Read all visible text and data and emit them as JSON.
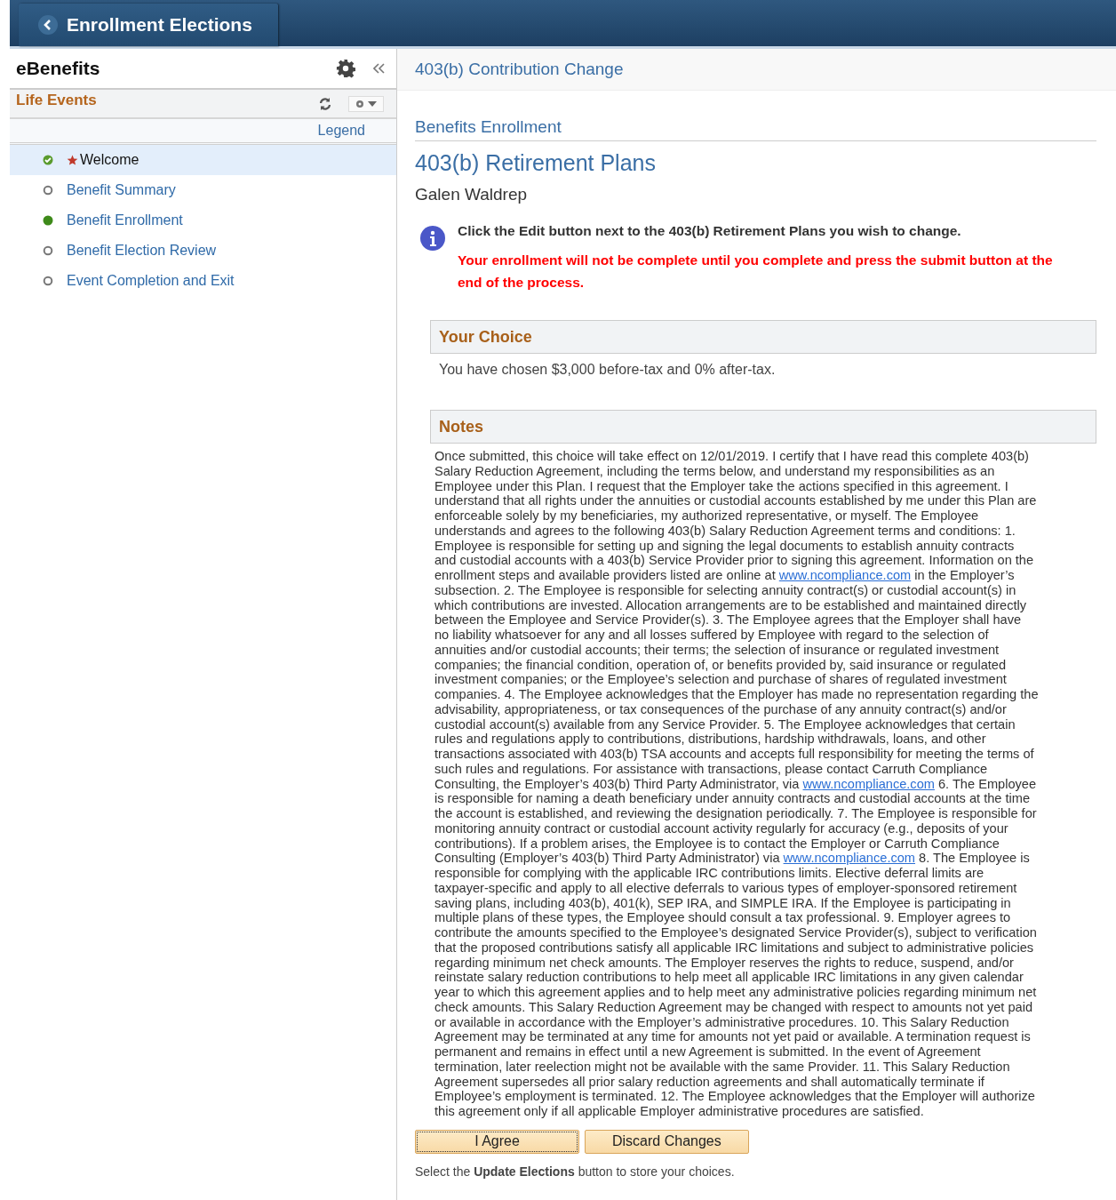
{
  "header": {
    "title": "Enrollment Elections"
  },
  "sidebar": {
    "title": "eBenefits",
    "section": "Life Events",
    "legend": "Legend",
    "items": [
      {
        "label": "Welcome",
        "kind": "complete",
        "required": true,
        "selected": true
      },
      {
        "label": "Benefit Summary",
        "kind": "pending",
        "required": false,
        "selected": false
      },
      {
        "label": "Benefit Enrollment",
        "kind": "current",
        "required": false,
        "selected": false
      },
      {
        "label": "Benefit Election Review",
        "kind": "pending",
        "required": false,
        "selected": false
      },
      {
        "label": "Event Completion and Exit",
        "kind": "pending",
        "required": false,
        "selected": false
      }
    ]
  },
  "content": {
    "page_title": "403(b) Contribution Change",
    "section": "Benefits Enrollment",
    "heading": "403(b) Retirement Plans",
    "employee": "Galen Waldrep",
    "info": "Click the Edit button next to the 403(b) Retirement Plans you wish to change.",
    "warning": "Your enrollment will not be complete until you complete and press the submit button at the end of the process.",
    "choice": {
      "title": "Your Choice",
      "text": "You have chosen $3,000 before-tax and 0% after-tax."
    },
    "notes": {
      "title": "Notes",
      "segments": [
        {
          "kind": "text",
          "text": "Once submitted, this choice will take effect on 12/01/2019. I certify that I have read this complete 403(b) Salary Reduction Agreement, including the terms below, and understand my responsibilities as an Employee under this Plan. I request that the Employer take the actions specified in this agreement. I understand that all rights under the annuities or custodial accounts established by me under this Plan are enforceable solely by my beneficiaries, my authorized representative, or myself. The Employee understands and agrees to the following 403(b) Salary Reduction Agreement terms and conditions: 1. Employee is responsible for setting up and signing the legal documents to establish annuity contracts and custodial accounts with a 403(b) Service Provider prior to signing this agreement. Information on the enrollment steps and available providers listed are online at "
        },
        {
          "kind": "link",
          "text": "www.ncompliance.com"
        },
        {
          "kind": "text",
          "text": " in the Employer’s subsection. 2. The Employee is responsible for selecting annuity contract(s) or custodial account(s) in which contributions are invested. Allocation arrangements are to be established and maintained directly between the Employee and Service Provider(s). 3. The Employee agrees that the Employer shall have no liability whatsoever for any and all losses suffered by Employee with regard to the selection of annuities and/or custodial accounts; their terms; the selection of insurance or regulated investment companies; the financial condition, operation of, or benefits provided by, said insurance or regulated investment companies; or the Employee’s selection and purchase of shares of regulated investment companies. 4. The Employee acknowledges that the Employer has made no representation regarding the advisability, appropriateness, or tax consequences of the purchase of any annuity contract(s) and/or custodial account(s) available from any Service Provider. 5. The Employee acknowledges that certain rules and regulations apply to contributions, distributions, hardship withdrawals, loans, and other transactions associated with 403(b) TSA accounts and accepts full responsibility for meeting the terms of such rules and regulations. For assistance with transactions, please contact Carruth Compliance Consulting, the Employer’s 403(b) Third Party Administrator, via "
        },
        {
          "kind": "link",
          "text": "www.ncompliance.com"
        },
        {
          "kind": "text",
          "text": " 6. The Employee is responsible for naming a death beneficiary under annuity contracts and custodial accounts at the time the account is established, and reviewing the designation periodically. 7. The Employee is responsible for monitoring annuity contract or custodial account activity regularly for accuracy (e.g., deposits of your contributions). If a problem arises, the Employee is to contact the Employer or Carruth Compliance Consulting (Employer’s 403(b) Third Party Administrator) via "
        },
        {
          "kind": "link",
          "text": "www.ncompliance.com"
        },
        {
          "kind": "text",
          "text": " 8. The Employee is responsible for complying with the applicable IRC contributions limits. Elective deferral limits are taxpayer-specific and apply to all elective deferrals to various types of employer-sponsored retirement saving plans, including 403(b), 401(k), SEP IRA, and SIMPLE IRA. If the Employee is participating in multiple plans of these types, the Employee should consult a tax professional. 9. Employer agrees to contribute the amounts specified to the Employee’s designated Service Provider(s), subject to verification that the proposed contributions satisfy all applicable IRC limitations and subject to administrative policies regarding minimum net check amounts. The Employer reserves the rights to reduce, suspend, and/or reinstate salary reduction contributions to help meet all applicable IRC limitations in any given calendar year to which this agreement applies and to help meet any administrative policies regarding minimum net check amounts. This Salary Reduction Agreement may be changed with respect to amounts not yet paid or available in accordance with the Employer’s administrative procedures. 10. This Salary Reduction Agreement may be terminated at any time for amounts not yet paid or available. A termination request is permanent and remains in effect until a new Agreement is submitted. In the event of Agreement termination, later reelection might not be available with the same Provider. 11. This Salary Reduction Agreement supersedes all prior salary reduction agreements and shall automatically terminate if Employee’s employment is terminated. 12. The Employee acknowledges that the Employer will authorize this agreement only if all applicable Employer administrative procedures are satisfied."
        }
      ]
    },
    "buttons": [
      {
        "label": "I Agree",
        "focused": true
      },
      {
        "label": "Discard Changes",
        "focused": false
      }
    ],
    "footer": "Select the **Update Elections** button to store your choices."
  }
}
